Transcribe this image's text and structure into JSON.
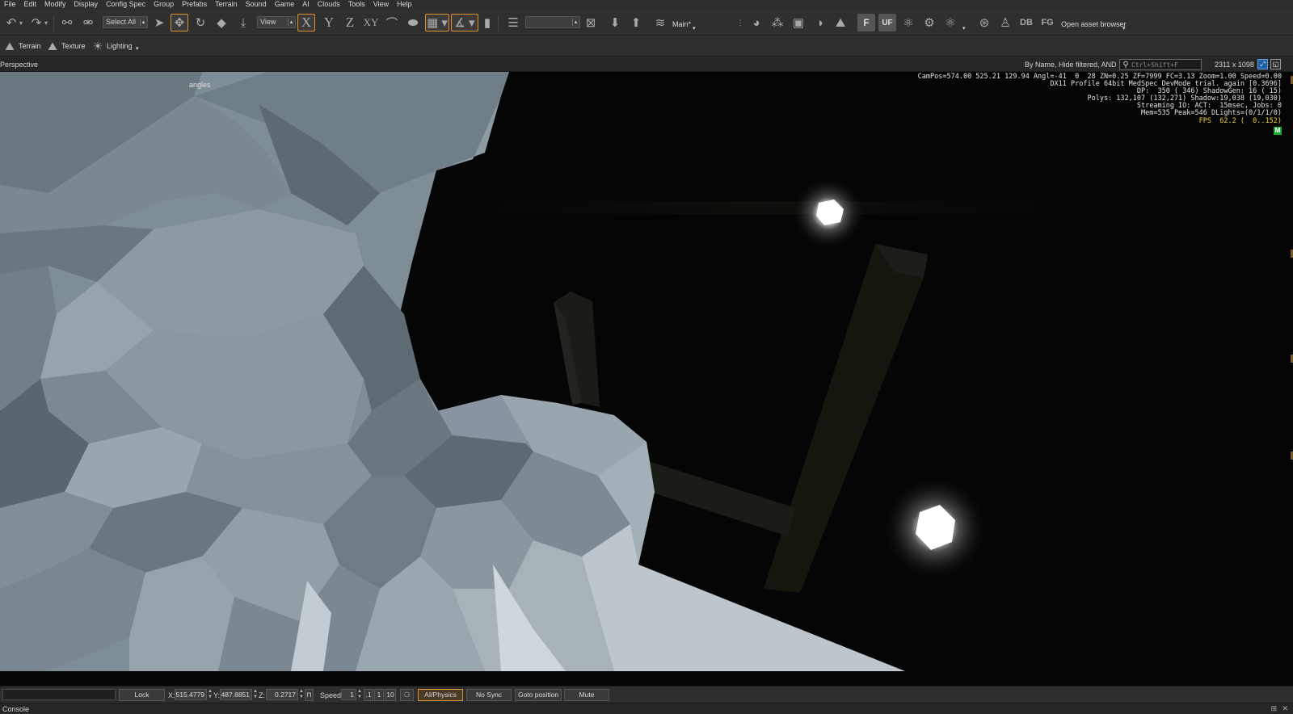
{
  "menu": [
    "File",
    "Edit",
    "Modify",
    "Display",
    "Config Spec",
    "Group",
    "Prefabs",
    "Terrain",
    "Sound",
    "Game",
    "AI",
    "Clouds",
    "Tools",
    "View",
    "Help"
  ],
  "toolbar": {
    "select_all": "Select All",
    "view_combo": "View",
    "axis_x": "X",
    "axis_y": "Y",
    "axis_z": "Z",
    "axis_xy": "XY",
    "layer": "Main*",
    "db": "DB",
    "fg": "FG",
    "f_icon": "F",
    "uf_icon": "UF",
    "open_asset_browser": "Open asset browser"
  },
  "toolbar2": {
    "terrain": "Terrain",
    "texture": "Texture",
    "lighting": "Lighting"
  },
  "viewport": {
    "title": "Perspective",
    "filter": "By Name, Hide filtered, AND",
    "search_placeholder": "Ctrl+Shift+F",
    "resolution": "2311 x 1098",
    "annotation": "angles",
    "hud": [
      "CamPos=574.00 525.21 129.94 Angl=-41  0  28 ZN=0.25 ZF=7999 FC=3.13 Zoom=1.00 Speed=0.00",
      "DX11 Profile 64bit MedSpec DevMode trial. again [0.3696]",
      "DP:  350 ( 346) ShadowGen: 16 ( 15)",
      "Polys: 132,107 (132,271) Shadow:19,038 (19,030)",
      "Streaming IO: ACT:  15msec, Jobs: 0",
      "Mem=535 Peak=546 DLights=(0/1/1/0)"
    ],
    "fps": "FPS  62.2 (  0..152)",
    "hud_badge": "M"
  },
  "statusbar": {
    "lock_selection": "Lock Selection",
    "x_label": "X:",
    "x_value": "515.4779",
    "y_label": "Y:",
    "y_value": "487.8851",
    "z_label": "Z:",
    "z_value": "0.2717",
    "speed_label": "Speed:",
    "speed_value": "1",
    "speed_presets": [
      ".1",
      "1",
      "10"
    ],
    "ai_physics": "AI/Physics",
    "no_sync_player": "No Sync Player",
    "goto_position": "Goto position",
    "mute": "Mute"
  },
  "console": {
    "label": "Console"
  },
  "colors": {
    "accent": "#e0902c",
    "background": "#2b2b2b",
    "viewport": "#050505",
    "rock": "#8a99a3",
    "fps": "#f0d23c"
  }
}
